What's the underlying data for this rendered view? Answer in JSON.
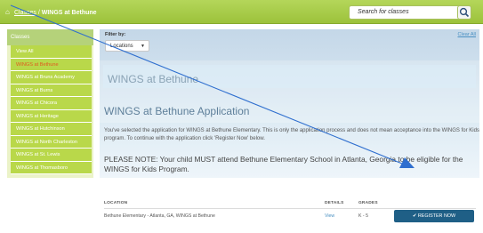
{
  "breadcrumb": {
    "home_icon": "home-icon",
    "parent": "Classes",
    "separator": "/",
    "current": "WINGS at Bethune"
  },
  "search": {
    "placeholder": "Search for classes",
    "icon": "search-icon"
  },
  "sidebar": {
    "heading": "Classes",
    "items": [
      {
        "label": "View All"
      },
      {
        "label": "WINGS at Bethune",
        "active": true
      },
      {
        "label": "WINGS at Bruns Academy"
      },
      {
        "label": "WINGS at Burns"
      },
      {
        "label": "WINGS at Chicora"
      },
      {
        "label": "WINGS at Heritage"
      },
      {
        "label": "WINGS at Hutchinson"
      },
      {
        "label": "WINGS at North Charleston"
      },
      {
        "label": "WINGS at St. Lewis"
      },
      {
        "label": "WINGS at Thomasboro"
      }
    ]
  },
  "filter": {
    "label": "Filter by:",
    "clear_all": "Clear All",
    "selected": "Locations",
    "caret_icon": "caret-down-icon"
  },
  "class_card": {
    "title": "WINGS at Bethune"
  },
  "application": {
    "title": "WINGS at Bethune Application",
    "description": "You've selected the application for WINGS at Bethune Elementary. This is only the application process and does not mean acceptance into the WINGS for Kids program.  To continue with the application click 'Register Now' below.",
    "note": "PLEASE NOTE:  Your child MUST attend Bethune Elementary School in Atlanta, Georgia to be eligible for the WINGS for Kids Program."
  },
  "table": {
    "headers": {
      "location": "LOCATION",
      "details": "DETAILS",
      "grades": "GRADES"
    },
    "row": {
      "location": "Bethune Elementary - Atlanta, GA, WINGS at Bethune",
      "details": "View",
      "grades": "K - 5",
      "register_icon": "check-icon",
      "register_label": "REGISTER NOW"
    }
  },
  "colors": {
    "header_green": "#9cc23b",
    "sidebar_green": "#b9d84a",
    "active_orange": "#e05a20",
    "button_blue": "#1f5f86",
    "annotation_line": "#2f6fcf"
  }
}
